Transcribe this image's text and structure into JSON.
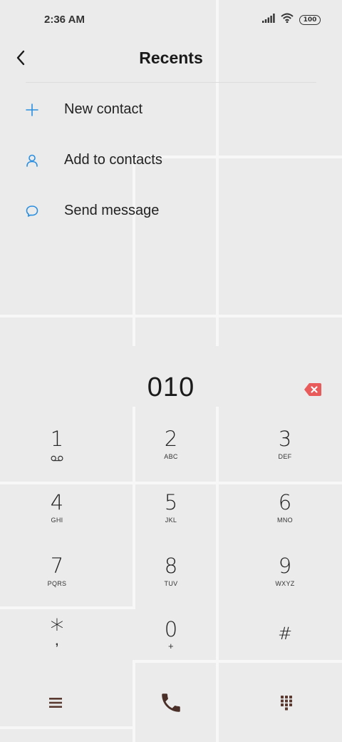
{
  "status_bar": {
    "time": "2:36 AM",
    "battery": "100",
    "icons": [
      "signal-icon",
      "wifi-icon",
      "battery-icon"
    ]
  },
  "header": {
    "title": "Recents",
    "back_icon": "back-arrow-icon"
  },
  "menu": {
    "items": [
      {
        "label": "New contact",
        "icon": "plus-icon"
      },
      {
        "label": "Add to contacts",
        "icon": "person-icon"
      },
      {
        "label": "Send message",
        "icon": "message-bubble-icon"
      }
    ]
  },
  "dialer": {
    "number": "010",
    "backspace_icon": "backspace-icon",
    "keys": [
      {
        "digit": "1",
        "sub": ""
      },
      {
        "digit": "2",
        "sub": "ABC"
      },
      {
        "digit": "3",
        "sub": "DEF"
      },
      {
        "digit": "4",
        "sub": "GHI"
      },
      {
        "digit": "5",
        "sub": "JKL"
      },
      {
        "digit": "6",
        "sub": "MNO"
      },
      {
        "digit": "7",
        "sub": "PQRS"
      },
      {
        "digit": "8",
        "sub": "TUV"
      },
      {
        "digit": "9",
        "sub": "WXYZ"
      },
      {
        "digit": "*",
        "sub": ","
      },
      {
        "digit": "0",
        "sub": "+"
      },
      {
        "digit": "#",
        "sub": ""
      }
    ]
  },
  "bottom_bar": {
    "icons": [
      "menu-icon",
      "call-icon",
      "dialpad-icon"
    ]
  },
  "colors": {
    "accent": "#2a8fe0",
    "backspace": "#e95a5a",
    "bottom_icons": "#5a3a30",
    "background": "#ebebeb"
  }
}
